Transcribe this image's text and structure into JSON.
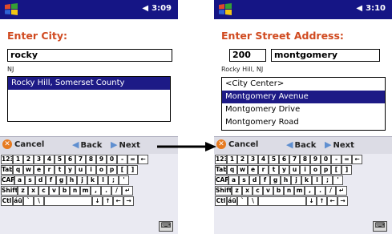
{
  "screens": [
    {
      "clock": "3:09",
      "heading": "Enter City:",
      "fields": [
        "rocky"
      ],
      "region": "NJ",
      "list_items": [
        {
          "label": "Rocky Hill, Somerset County",
          "selected": true
        }
      ],
      "commands": {
        "cancel": "Cancel",
        "back": "Back",
        "next": "Next"
      }
    },
    {
      "clock": "3:10",
      "heading": "Enter Street Address:",
      "fields": [
        "200",
        "montgomery"
      ],
      "region": "Rocky Hill, NJ",
      "list_items": [
        {
          "label": "<City Center>",
          "selected": false
        },
        {
          "label": "Montgomery Avenue",
          "selected": true
        },
        {
          "label": "Montgomery Drive",
          "selected": false
        },
        {
          "label": "Montgomery Road",
          "selected": false
        }
      ],
      "commands": {
        "cancel": "Cancel",
        "back": "Back",
        "next": "Next"
      }
    }
  ],
  "keyboard": {
    "rows": [
      [
        "123",
        "1",
        "2",
        "3",
        "4",
        "5",
        "6",
        "7",
        "8",
        "9",
        "0",
        "-",
        "=",
        "←"
      ],
      [
        "Tab",
        "q",
        "w",
        "e",
        "r",
        "t",
        "y",
        "u",
        "i",
        "o",
        "p",
        "[",
        "]"
      ],
      [
        "CAP",
        "a",
        "s",
        "d",
        "f",
        "g",
        "h",
        "j",
        "k",
        "l",
        ";",
        "'"
      ],
      [
        "Shift",
        "z",
        "x",
        "c",
        "v",
        "b",
        "n",
        "m",
        ",",
        ".",
        "/",
        "↵"
      ],
      [
        "Ctl",
        "áü",
        "`",
        "\\",
        " ",
        "↓",
        "↑",
        "←",
        "→"
      ]
    ]
  },
  "colors": {
    "titlebar": "#151585",
    "heading": "#d04a20",
    "selection": "#1d1a86"
  }
}
